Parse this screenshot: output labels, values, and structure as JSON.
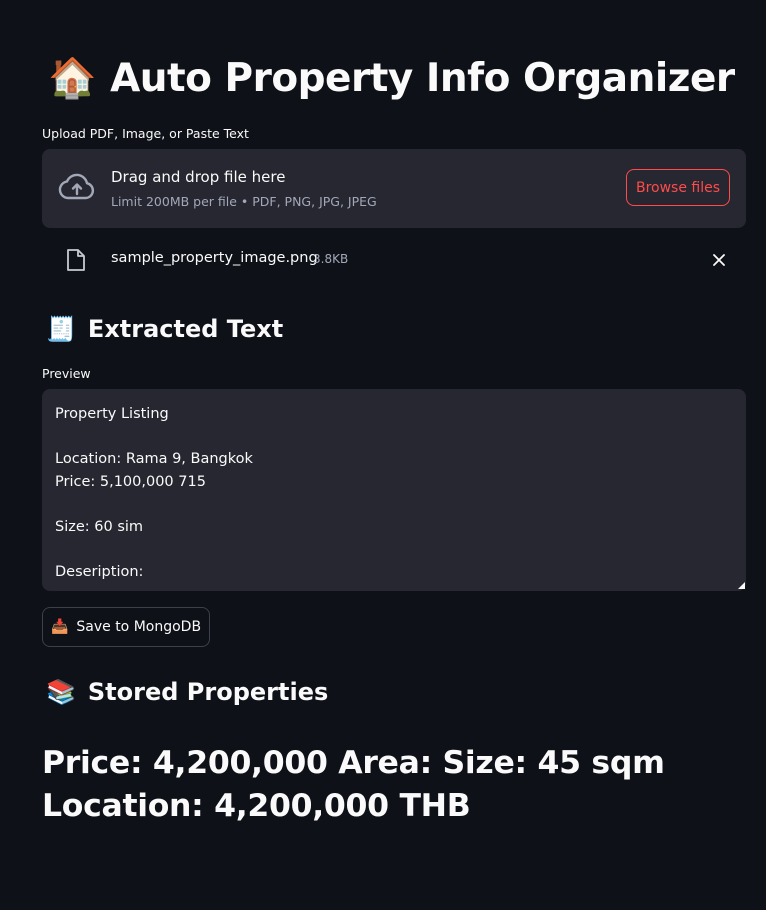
{
  "header": {
    "icon": "house-icon",
    "icon_glyph": "🏠",
    "title": "Auto Property Info Organizer"
  },
  "uploader": {
    "label": "Upload PDF, Image, or Paste Text",
    "icon": "cloud-upload-icon",
    "drop_text": "Drag and drop file here",
    "limit_text": "Limit 200MB per file • PDF, PNG, JPG, JPEG",
    "browse_label": "Browse files",
    "accent_color": "#ff4b4b"
  },
  "uploaded_file": {
    "icon": "file-icon",
    "name": "sample_property_image.png",
    "size": "3.8KB"
  },
  "extracted_section": {
    "icon": "receipt-icon",
    "icon_glyph": "🧾",
    "heading": "Extracted Text",
    "preview_label": "Preview",
    "preview_text": "Property Listing\n\nLocation: Rama 9, Bangkok\nPrice: 5,100,000 715\n\nSize: 60 sim\n\nDeseription:"
  },
  "actions": {
    "save_icon": "inbox-tray-icon",
    "save_icon_glyph": "📥",
    "save_label": "Save to MongoDB"
  },
  "stored_section": {
    "icon": "books-icon",
    "icon_glyph": "📚",
    "heading": "Stored Properties",
    "entry_text": "Price: 4,200,000 Area: Size: 45 sqm Location: 4,200,000 THB"
  },
  "theme": {
    "background": "#0e1117",
    "panel": "#262730",
    "text": "#fafafa",
    "muted": "#a3a8b8"
  }
}
